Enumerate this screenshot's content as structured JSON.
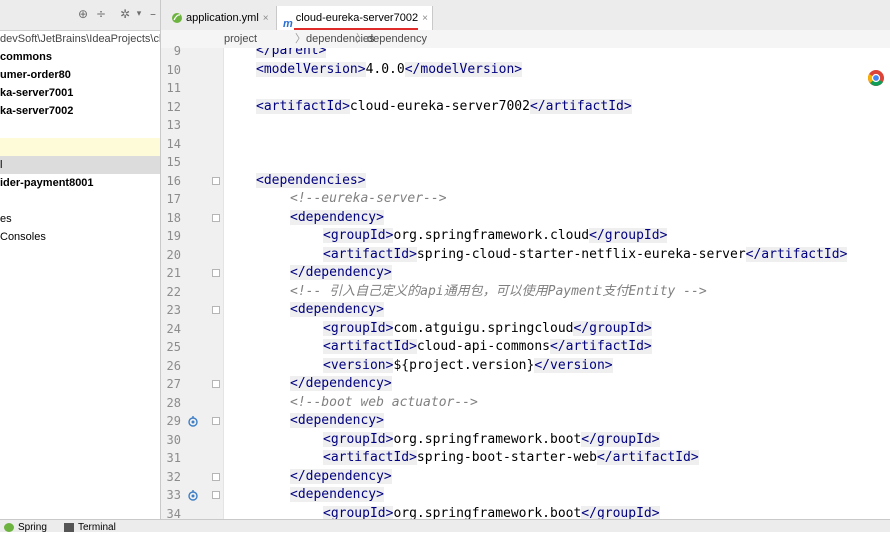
{
  "project_panel": {
    "path_row": "devSoft\\JetBrains\\IdeaProjects\\cl",
    "tree": [
      {
        "label": "commons",
        "bold": true
      },
      {
        "label": "umer-order80",
        "bold": true
      },
      {
        "label": "ka-server7001",
        "bold": true
      },
      {
        "label": "ka-server7002",
        "bold": true
      },
      {
        "label": "",
        "bold": false
      },
      {
        "label": "",
        "bold": false,
        "highlight": true
      },
      {
        "label": "l",
        "bold": false,
        "selected": true
      },
      {
        "label": "ider-payment8001",
        "bold": true
      },
      {
        "label": "",
        "bold": false
      },
      {
        "label": "es",
        "bold": false
      },
      {
        "label": "Consoles",
        "bold": false
      }
    ]
  },
  "tabs": [
    {
      "label": "application.yml",
      "close": "×"
    },
    {
      "label": "cloud-eureka-server7002",
      "close": "×",
      "active": true
    }
  ],
  "breadcrumb": [
    "project",
    "dependencies",
    "dependency"
  ],
  "bottom": {
    "spring": "Spring",
    "terminal": "Terminal"
  },
  "code": [
    {
      "n": "9",
      "html": "<span class=\"tag\">&lt;/parent&gt;</span>",
      "indent": 1
    },
    {
      "n": "10",
      "indent": 1
    },
    {
      "n": "11",
      "indent": 0
    },
    {
      "n": "12",
      "indent": 1
    },
    {
      "n": "13",
      "indent": 0
    },
    {
      "n": "14",
      "indent": 0
    },
    {
      "n": "15",
      "indent": 0
    },
    {
      "n": "16",
      "indent": 1
    },
    {
      "n": "17",
      "indent": 2
    },
    {
      "n": "18",
      "indent": 2
    },
    {
      "n": "19",
      "indent": 3
    },
    {
      "n": "20",
      "indent": 3
    },
    {
      "n": "21",
      "indent": 2
    },
    {
      "n": "22",
      "indent": 2
    },
    {
      "n": "23",
      "indent": 2
    },
    {
      "n": "24",
      "indent": 3
    },
    {
      "n": "25",
      "indent": 3
    },
    {
      "n": "26",
      "indent": 3
    },
    {
      "n": "27",
      "indent": 2
    },
    {
      "n": "28",
      "indent": 2
    },
    {
      "n": "29",
      "indent": 2
    },
    {
      "n": "30",
      "indent": 3
    },
    {
      "n": "31",
      "indent": 3
    },
    {
      "n": "32",
      "indent": 2
    },
    {
      "n": "33",
      "indent": 2
    },
    {
      "n": "34",
      "indent": 3
    }
  ],
  "code_text": {
    "l9": "</parent>",
    "l10_open": "<modelVersion>",
    "l10_val": "4.0.0",
    "l10_close": "</modelVersion>",
    "l12_open": "<artifactId>",
    "l12_val": "cloud-eureka-server7002",
    "l12_close": "</artifactId>",
    "l16": "<dependencies>",
    "l17": "<!--eureka-server-->",
    "l18": "<dependency>",
    "l19_open": "<groupId>",
    "l19_val": "org.springframework.cloud",
    "l19_close": "</groupId>",
    "l20_open": "<artifactId>",
    "l20_val": "spring-cloud-starter-netflix-eureka-server",
    "l20_close": "</artifactId>",
    "l21": "</dependency>",
    "l22": "<!-- 引入自己定义的api通用包，可以使用Payment支付Entity -->",
    "l23": "<dependency>",
    "l24_open": "<groupId>",
    "l24_val": "com.atguigu.springcloud",
    "l24_close": "</groupId>",
    "l25_open": "<artifactId>",
    "l25_val": "cloud-api-commons",
    "l25_close": "</artifactId>",
    "l26_open": "<version>",
    "l26_val": "${project.version}",
    "l26_close": "</version>",
    "l27": "</dependency>",
    "l28": "<!--boot web actuator-->",
    "l29": "<dependency>",
    "l30_open": "<groupId>",
    "l30_val": "org.springframework.boot",
    "l30_close": "</groupId>",
    "l31_open": "<artifactId>",
    "l31_val": "spring-boot-starter-web",
    "l31_close": "</artifactId>",
    "l32": "</dependency>",
    "l33": "<dependency>",
    "l34_open": "<groupId>",
    "l34_val": "org.springframework.boot",
    "l34_close": "</groupId>"
  },
  "icons": {
    "accent_underline": "#e02b2b",
    "tag_color": "#000080",
    "comment_color": "#808080"
  }
}
